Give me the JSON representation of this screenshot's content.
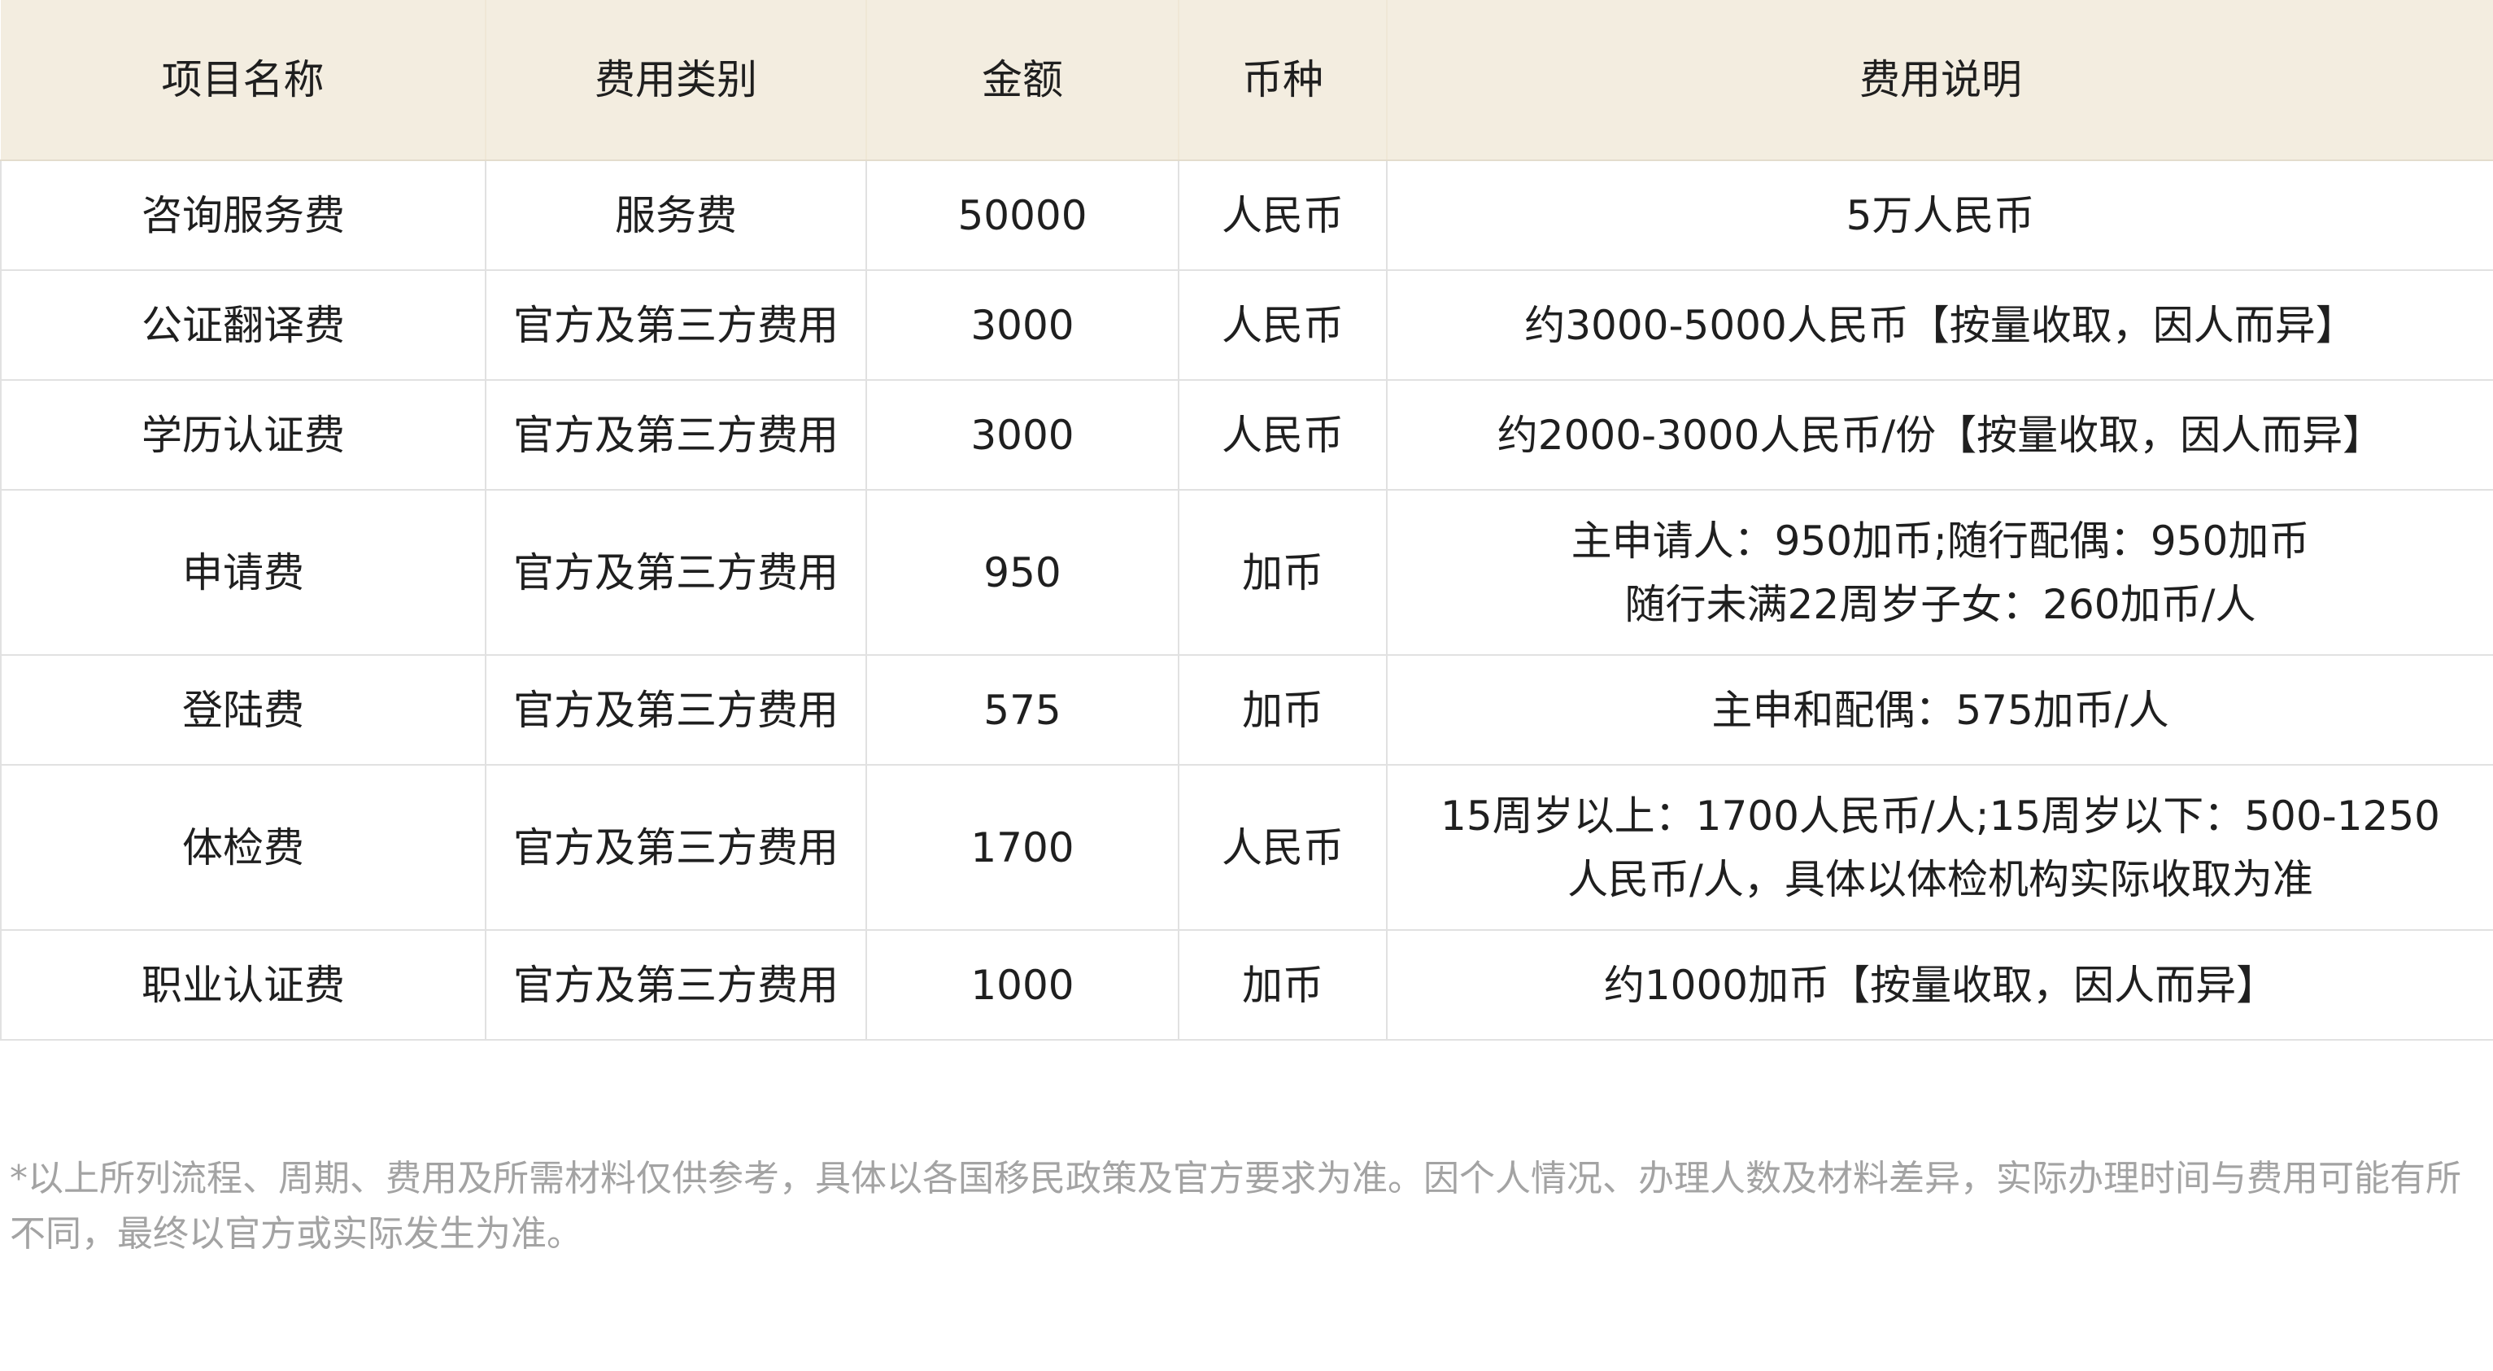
{
  "table": {
    "headers": [
      "项目名称",
      "费用类别",
      "金额",
      "币种",
      "费用说明"
    ],
    "rows": [
      {
        "name": "咨询服务费",
        "category": "服务费",
        "amount": "50000",
        "currency": "人民币",
        "desc": [
          "5万人民币"
        ]
      },
      {
        "name": "公证翻译费",
        "category": "官方及第三方费用",
        "amount": "3000",
        "currency": "人民币",
        "desc": [
          "约3000-5000人民币【按量收取，因人而异】"
        ]
      },
      {
        "name": "学历认证费",
        "category": "官方及第三方费用",
        "amount": "3000",
        "currency": "人民币",
        "desc": [
          "约2000-3000人民币/份【按量收取，因人而异】"
        ]
      },
      {
        "name": "申请费",
        "category": "官方及第三方费用",
        "amount": "950",
        "currency": "加币",
        "desc": [
          "主申请人：950加币;随行配偶：950加币",
          "随行未满22周岁子女：260加币/人"
        ]
      },
      {
        "name": "登陆费",
        "category": "官方及第三方费用",
        "amount": "575",
        "currency": "加币",
        "desc": [
          "主申和配偶：575加币/人"
        ]
      },
      {
        "name": "体检费",
        "category": "官方及第三方费用",
        "amount": "1700",
        "currency": "人民币",
        "desc": [
          "15周岁以上：1700人民币/人;15周岁以下：500-1250",
          "人民币/人，具体以体检机构实际收取为准"
        ]
      },
      {
        "name": "职业认证费",
        "category": "官方及第三方费用",
        "amount": "1000",
        "currency": "加币",
        "desc": [
          "约1000加币【按量收取，因人而异】"
        ]
      }
    ]
  },
  "disclaimer": "*以上所列流程、周期、费用及所需材料仅供参考，具体以各国移民政策及官方要求为准。因个人情况、办理人数及材料差异，实际办理时间与费用可能有所不同，最终以官方或实际发生为准。"
}
